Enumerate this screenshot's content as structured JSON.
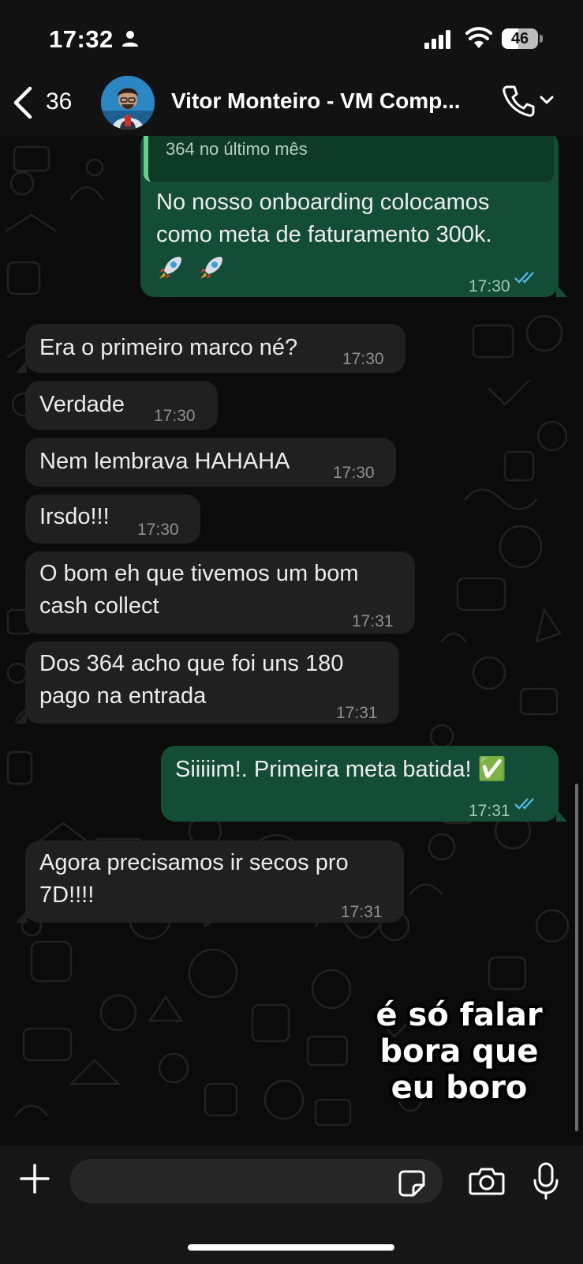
{
  "status_bar": {
    "time": "17:32",
    "battery": "46",
    "battery_level": 0.46
  },
  "header": {
    "back_count": "36",
    "contact_name": "Vitor Monteiro - VM Comp...",
    "icons": [
      "chevron-left-icon",
      "avatar",
      "phone-icon",
      "chevron-down-icon"
    ]
  },
  "messages": [
    {
      "direction": "outgoing",
      "quoted_text": "364 no último mês",
      "lines": [
        "No nosso onboarding colocamos",
        "como meta de faturamento 300k."
      ],
      "emoji": "🚀🚀",
      "time": "17:30",
      "status": "read"
    },
    {
      "direction": "incoming",
      "lines": [
        "Era o primeiro marco né?"
      ],
      "time": "17:30"
    },
    {
      "direction": "incoming",
      "lines": [
        "Verdade"
      ],
      "time": "17:30"
    },
    {
      "direction": "incoming",
      "lines": [
        "Nem lembrava HAHAHA"
      ],
      "time": "17:30"
    },
    {
      "direction": "incoming",
      "lines": [
        "Irsdo!!!"
      ],
      "time": "17:30"
    },
    {
      "direction": "incoming",
      "lines": [
        "O bom eh que tivemos um bom",
        "cash collect"
      ],
      "time": "17:31"
    },
    {
      "direction": "incoming",
      "lines": [
        "Dos 364 acho que foi uns 180",
        "pago na entrada"
      ],
      "time": "17:31"
    },
    {
      "direction": "outgoing",
      "lines": [
        "Siiiiim!. Primeira meta batida! ✅"
      ],
      "time": "17:31",
      "status": "read"
    },
    {
      "direction": "incoming",
      "lines": [
        "Agora precisamos ir secos pro",
        "7D!!!!"
      ],
      "time": "17:31"
    }
  ],
  "sticker": {
    "lines": [
      "é só falar",
      "bora que",
      "eu boro"
    ]
  },
  "input_bar": {
    "icons": [
      "plus-icon",
      "sticker-icon",
      "camera-icon",
      "microphone-icon"
    ]
  },
  "colors": {
    "incoming_bubble": "#202020",
    "outgoing_bubble": "#144d37",
    "read_check": "#53bdeb",
    "quote_bar": "#65d18b"
  }
}
